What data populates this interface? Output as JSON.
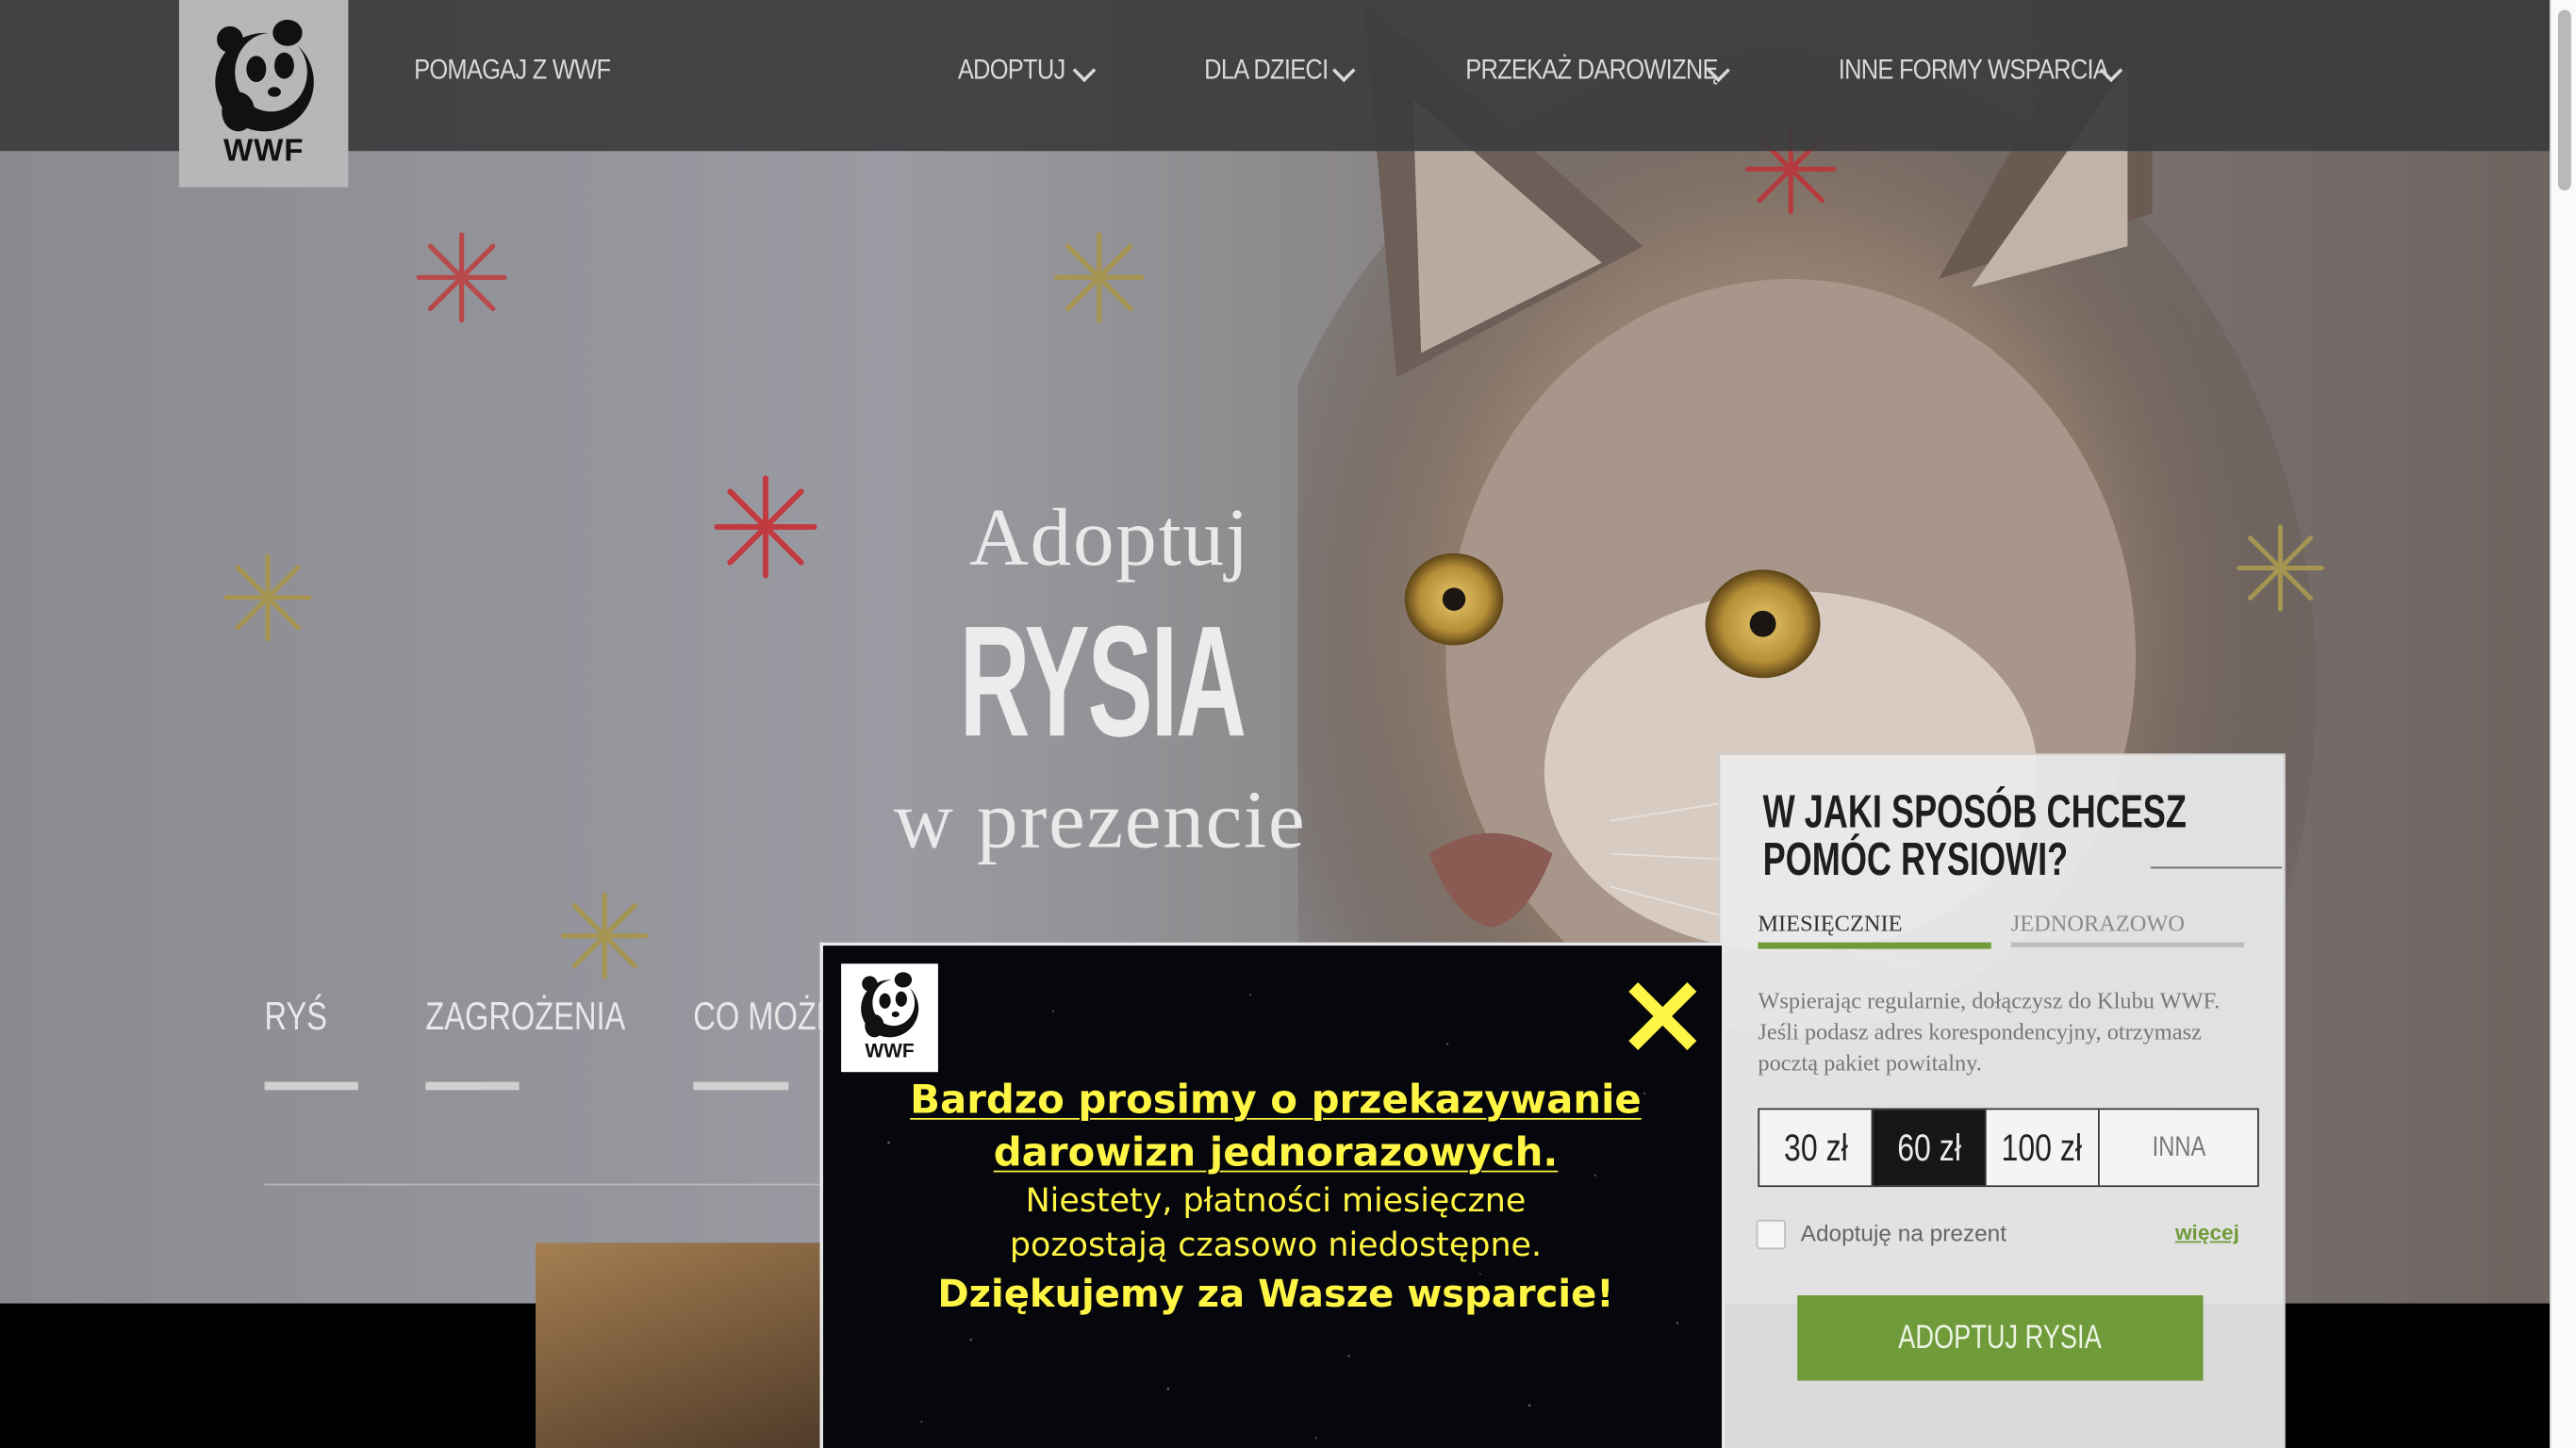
{
  "nav": {
    "brand": "WWF",
    "home_link": "POMAGAJ Z WWF",
    "items": [
      {
        "label": "ADOPTUJ"
      },
      {
        "label": "DLA DZIECI"
      },
      {
        "label": "PRZEKAŻ DAROWIZNĘ"
      },
      {
        "label": "INNE FORMY WSPARCIA"
      }
    ]
  },
  "hero": {
    "line1": "Adoptuj",
    "line2": "RYSIA",
    "line3": "w prezencie"
  },
  "section_tabs": [
    {
      "label": "RYŚ"
    },
    {
      "label": "ZAGROŻENIA"
    },
    {
      "label": "CO MOŻES"
    }
  ],
  "donation_panel": {
    "title": "W JAKI SPOSÓB CHCESZ POMÓC RYSIOWI?",
    "tab_monthly": "MIESIĘCZNIE",
    "tab_once": "JEDNORAZOWO",
    "description": "Wspierając regularnie, dołączysz do Klubu WWF. Jeśli podasz adres korespondencyjny, otrzymasz pocztą pakiet powitalny.",
    "amounts": [
      "30 zł",
      "60 zł",
      "100 zł",
      "INNA"
    ],
    "selected_amount": "60 zł",
    "gift_checkbox_label": "Adoptuję na prezent",
    "gift_checked": false,
    "more_link": "więcej",
    "cta": "ADOPTUJ RYSIA",
    "accent_color": "#6f9b3a"
  },
  "popup": {
    "brand": "WWF",
    "line1": "Bardzo prosimy o przekazywanie",
    "line2": "darowizn jednorazowych.",
    "line3": "Niestety, płatności miesięczne",
    "line4": "pozostają czasowo niedostępne.",
    "line5": "Dziękujemy za Wasze wsparcie!",
    "close_icon": "close-icon",
    "text_color": "#fff544"
  }
}
